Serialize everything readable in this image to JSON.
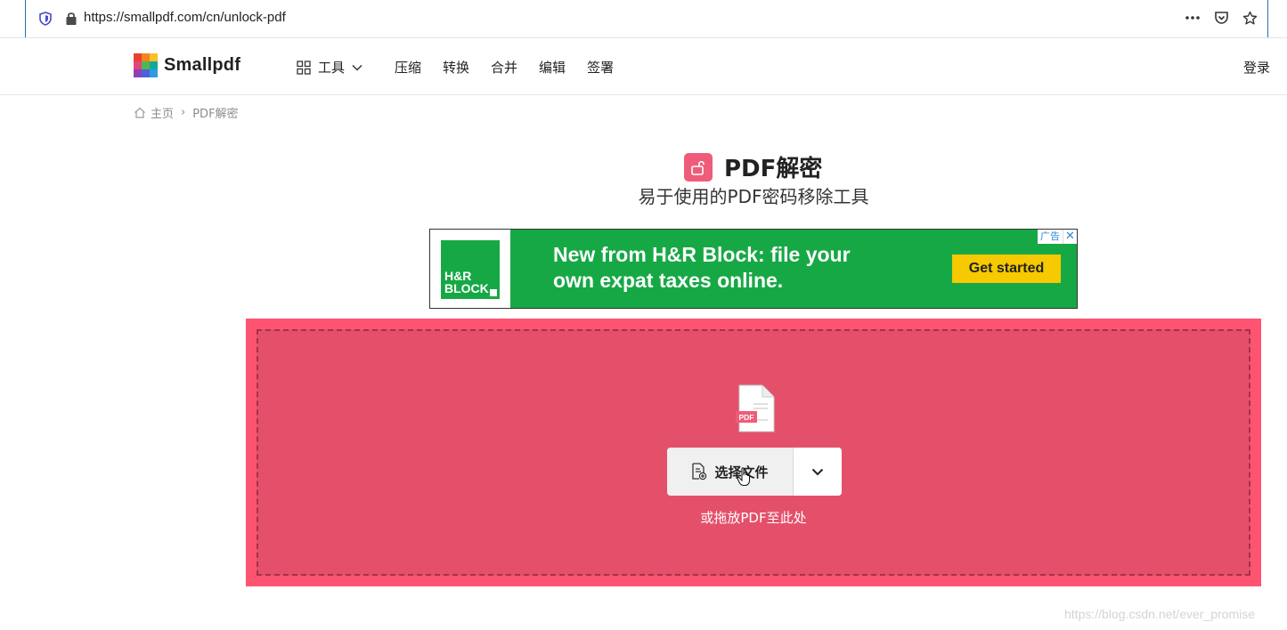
{
  "browser": {
    "url": "https://smallpdf.com/cn/unlock-pdf",
    "icons": [
      "shield-icon",
      "lock-icon",
      "more-icon",
      "pocket-icon",
      "star-icon"
    ]
  },
  "nav": {
    "brand": "Smallpdf",
    "tools_label": "工具",
    "menu": [
      {
        "label": "压缩"
      },
      {
        "label": "转换"
      },
      {
        "label": "合并"
      },
      {
        "label": "编辑"
      },
      {
        "label": "签署"
      }
    ],
    "login": "登录"
  },
  "breadcrumb": {
    "home": "主页",
    "separator": "›",
    "current": "PDF解密"
  },
  "page": {
    "title": "PDF解密",
    "subtitle": "易于使用的PDF密码移除工具"
  },
  "ad": {
    "logo_line1": "H&R",
    "logo_line2": "BLOCK",
    "headline_line1": "New from H&R Block: file your",
    "headline_line2": "own expat taxes online.",
    "cta": "Get started",
    "badge": "广告",
    "close": "✕",
    "color_green": "#17a846",
    "color_cta": "#f6c900"
  },
  "dropzone": {
    "file_badge": "PDF",
    "choose_label": "选择文件",
    "drop_hint": "或拖放PDF至此处",
    "color": "#fe5472"
  },
  "watermark": "https://blog.csdn.net/ever_promise"
}
